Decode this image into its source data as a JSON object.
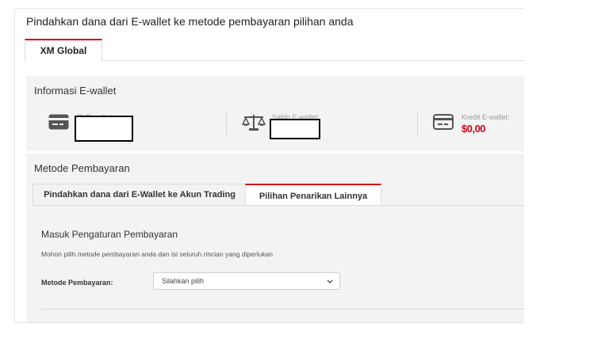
{
  "page": {
    "title": "Pindahkan dana dari E-wallet ke metode pembayaran pilihan anda"
  },
  "top_tabs": [
    {
      "label": "XM Global",
      "active": true
    }
  ],
  "ewallet_info": {
    "title": "Informasi E-wallet",
    "id_label": "ID E-wallet:",
    "balance_label": "Saldo E-wallet:",
    "credit_label": "Kredit E-wallet:",
    "credit_value": "$0,00"
  },
  "payment_method": {
    "title": "Metode Pembayaran",
    "tabs": [
      {
        "label": "Pindahkan dana dari E-Wallet ke Akun Trading",
        "active": false
      },
      {
        "label": "Pilihan Penarikan Lainnya",
        "active": true
      }
    ],
    "panel": {
      "title": "Masuk Pengaturan Pembayaran",
      "description": "Mohon pilih metode pembayaran anda dan isi seluruh rincian yang diperlukan",
      "field_label": "Metode Pembayaran:",
      "select_value": "Silahkan pilih"
    }
  },
  "colors": {
    "accent": "#d0021b",
    "section_bg": "#f3f3f3",
    "icon": "#555555"
  },
  "icons": [
    "card-icon",
    "scale-icon",
    "credit-card-icon",
    "chevron-down-icon"
  ]
}
